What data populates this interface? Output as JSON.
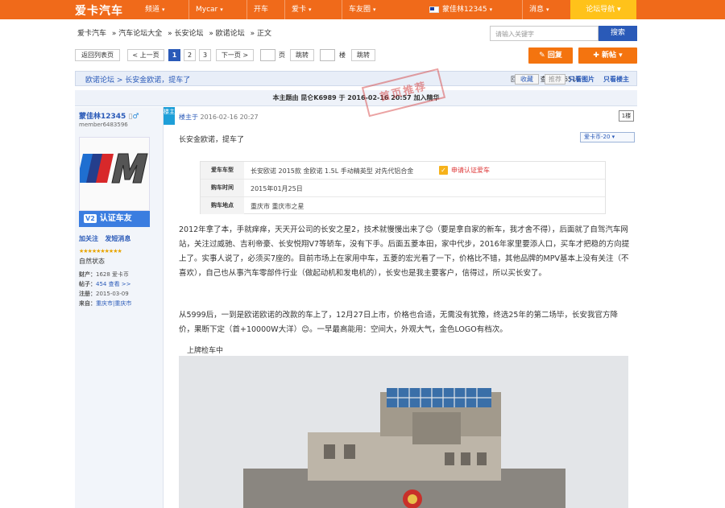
{
  "header": {
    "logo": "爱卡汽车",
    "nav": [
      "频道",
      "Mycar",
      "开车",
      "爱卡",
      "车友圈"
    ],
    "user": "蒙佳林12345",
    "messages": "消息",
    "guide": "论坛导航"
  },
  "breadcrumb": [
    "爱卡汽车",
    "» 汽车论坛大全",
    "» 长安论坛",
    "» 欧诺论坛",
    "» 正文"
  ],
  "search": {
    "placeholder": "请输入关键字",
    "button": "搜索"
  },
  "pagination": {
    "back": "返回列表页",
    "prev": "< 上一页",
    "pages": [
      "1",
      "2",
      "3"
    ],
    "next": "下一页 >",
    "page_unit": "页",
    "jump": "跳转",
    "floor_unit": "楼",
    "jump2": "跳转",
    "reply": "回复",
    "new_post": "新帖"
  },
  "thread": {
    "path": "欧诺论坛 > 长安金欧诺，提车了",
    "replies_label": "回复：",
    "replies": "20",
    "views_label": "查看：",
    "views": "56519",
    "favorite": "收藏",
    "recommend": "推荐",
    "only_images": "只看图片",
    "only_owner": "只看楼主",
    "subject": "本主题由 昆仑K6989 于 2016-02-16 20:57 加入精华",
    "stamp": "首页推荐"
  },
  "user_panel": {
    "name": "蒙佳林12345",
    "uid": "member6483596",
    "badge_v": "V2",
    "badge": "认证车友",
    "follow": "加关注",
    "message": "发短消息",
    "stars": "★★★★★★★★★★",
    "level": "自然状态",
    "info": [
      {
        "label": "财产：",
        "value": "1628 爱卡币"
      },
      {
        "label": "帖子：",
        "value": "454 查看 >>"
      },
      {
        "label": "注册：",
        "value": "2015-03-09"
      },
      {
        "label": "来自：",
        "value": "重庆市|重庆市"
      }
    ]
  },
  "post": {
    "floor_flag": "楼主",
    "author": "楼主于",
    "time": "2016-02-16 20:27",
    "floor": "1楼",
    "title": "长安金欧诺，提车了",
    "forum_select": "爱卡币-20",
    "info_rows": [
      {
        "label": "爱车车型",
        "value": "长安欧诺 2015款 金欧诺 1.5L 手动精英型 对先代铝合金",
        "extra": "申请认证爱车"
      },
      {
        "label": "购车时间",
        "value": "2015年01月25日"
      },
      {
        "label": "购车地点",
        "value": "重庆市 重庆市之星"
      }
    ],
    "para1": "2012年拿了本，手就痒痒，天天开公司的长安之星2，技术就慢慢出来了😊（要是拿自家的新车，我才舍不得），后面就了自驾汽车网站，关注过威驰、吉利帝豪、长安悦翔V7等轿车，没有下手。后面五菱本田，家中代步，2016年家里要添人口，买车才把稳的方向提上了。实事人说了，必须买7座的。目前市场上在家用中车，五菱的宏光看了一下，价格比不错，其他品牌的MPV基本上没有关注（不喜欢），自己也从事汽车零部件行业（做起动机和发电机的），长安也是我主要客户，信得过，所以买长安了。",
    "para2": "从5999后，一到是欧诺欧诺的改款的车上了，12月27日上市，价格也合适，无需没有犹豫，终选25年的第二场毕，长安我官方降价，果断下定（首+10000W大洋）😊。一早最高能用：空间大，外观大气，金色LOGO有档次。",
    "caption": "上牌检车中"
  }
}
